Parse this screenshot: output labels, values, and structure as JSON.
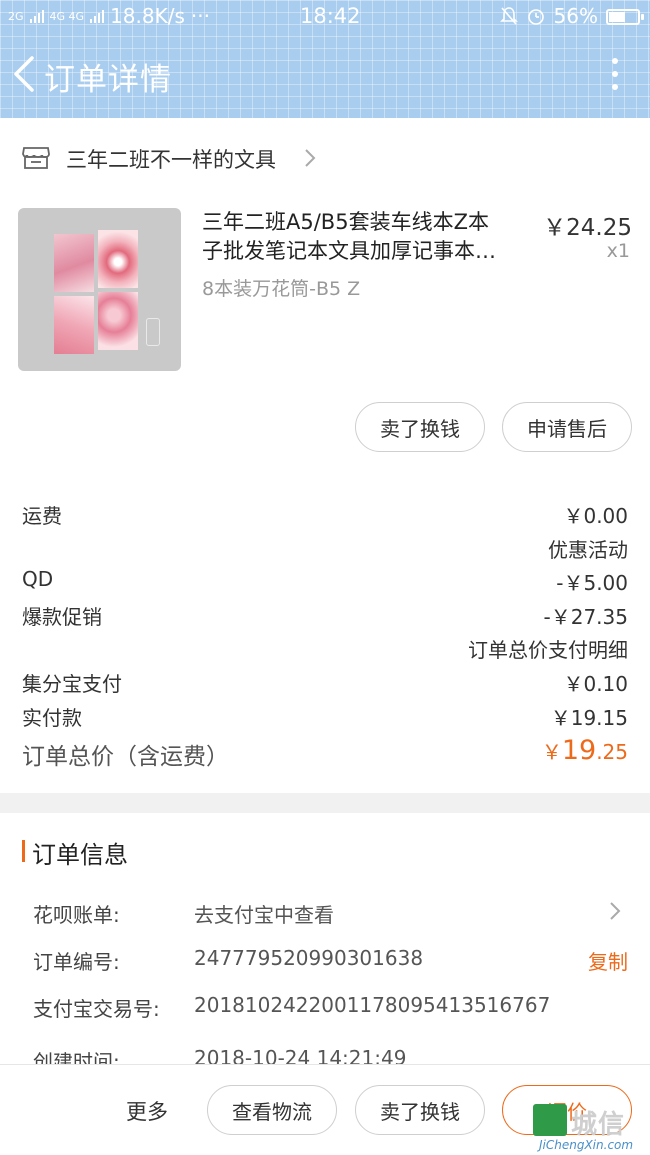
{
  "status_bar": {
    "signal_left": "2G",
    "signal_mid": "4G 4G",
    "net_speed": "18.8K/s",
    "dots": "···",
    "time": "18:42",
    "battery": "56%",
    "battery_level": 0.56
  },
  "header": {
    "title": "订单详情"
  },
  "shop": {
    "name": "三年二班不一样的文具"
  },
  "product": {
    "title_line1": "三年二班A5/B5套装车线本Z本",
    "title_line2": "子批发笔记本文具加厚记事本…",
    "variant": "8本装万花筒-B5 Z",
    "price": "￥24.25",
    "qty": "x1"
  },
  "item_actions": {
    "resell": "卖了换钱",
    "after_sale": "申请售后"
  },
  "fees": {
    "shipping_label": "运费",
    "shipping_value": "￥0.00",
    "promo_header": "优惠活动",
    "qd_label": "QD",
    "qd_value": "-￥5.00",
    "hot_label": "爆款促销",
    "hot_value": "-￥27.35",
    "pay_detail_header": "订单总价支付明细",
    "jfb_label": "集分宝支付",
    "jfb_value": "￥0.10",
    "paid_label": "实付款",
    "paid_value": "￥19.15",
    "total_label": "订单总价（含运费）",
    "total_currency": "￥",
    "total_int": "19",
    "total_dec": ".25"
  },
  "order_info": {
    "title": "订单信息",
    "huabei_label": "花呗账单:",
    "huabei_value": "去支付宝中查看",
    "order_no_label": "订单编号:",
    "order_no_value": "247779520990301638",
    "copy_label": "复制",
    "alipay_label": "支付宝交易号:",
    "alipay_value": "2018102422001178095413516767",
    "created_label": "创建时间:",
    "created_value": "2018-10-24 14:21:49"
  },
  "bottom_bar": {
    "more": "更多",
    "logistics": "查看物流",
    "resell": "卖了换钱",
    "review": "评价"
  },
  "watermark": {
    "cn": "城信",
    "en": "JiChengXin.com"
  },
  "colors": {
    "accent": "#ee6a1b",
    "header_bg": "#a9cdee"
  }
}
